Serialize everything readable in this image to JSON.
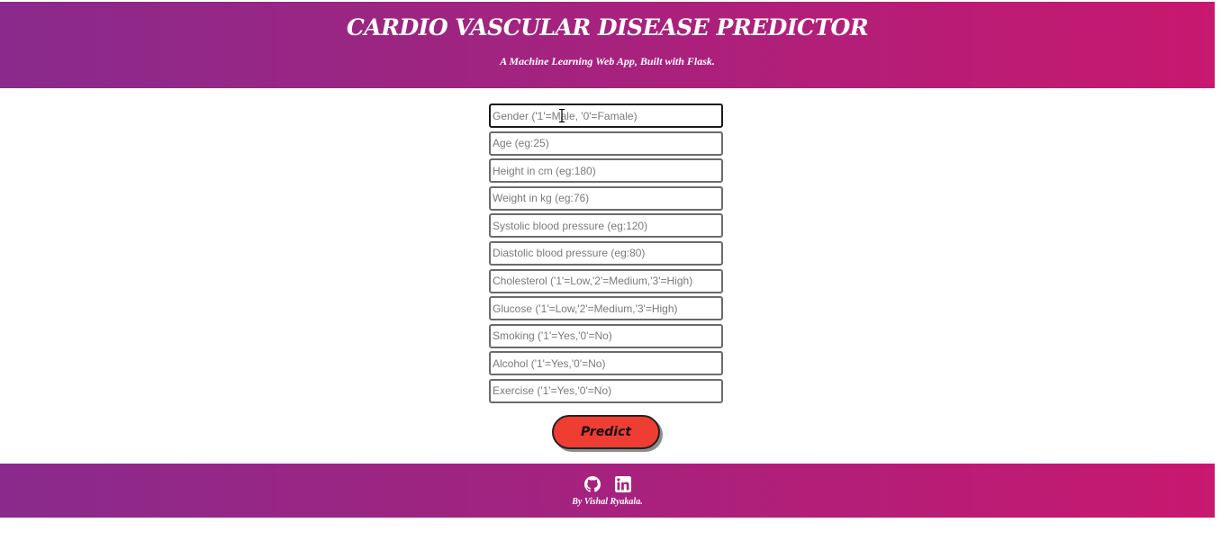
{
  "header": {
    "title": "CARDIO VASCULAR DISEASE PREDICTOR",
    "subtitle": "A Machine Learning Web App, Built with Flask."
  },
  "form": {
    "fields": [
      {
        "placeholder": "Gender ('1'=Male, '0'=Famale)",
        "value": ""
      },
      {
        "placeholder": "Age (eg:25)",
        "value": ""
      },
      {
        "placeholder": "Height in cm (eg:180)",
        "value": ""
      },
      {
        "placeholder": "Weight in kg (eg:76)",
        "value": ""
      },
      {
        "placeholder": "Systolic blood pressure (eg:120)",
        "value": ""
      },
      {
        "placeholder": "Diastolic blood pressure (eg:80)",
        "value": ""
      },
      {
        "placeholder": "Cholesterol ('1'=Low,'2'=Medium,'3'=High)",
        "value": ""
      },
      {
        "placeholder": "Glucose ('1'=Low,'2'=Medium,'3'=High)",
        "value": ""
      },
      {
        "placeholder": "Smoking ('1'=Yes,'0'=No)",
        "value": ""
      },
      {
        "placeholder": "Alcohol ('1'=Yes,'0'=No)",
        "value": ""
      },
      {
        "placeholder": "Exercise ('1'=Yes,'0'=No)",
        "value": ""
      }
    ],
    "predict_label": "Predict"
  },
  "footer": {
    "icons": [
      "github-icon",
      "linkedin-icon"
    ],
    "author": "By Vishal Ryakala."
  },
  "colors": {
    "gradient_start": "#8a2a8c",
    "gradient_end": "#c8186f",
    "button": "#ef3d33"
  }
}
